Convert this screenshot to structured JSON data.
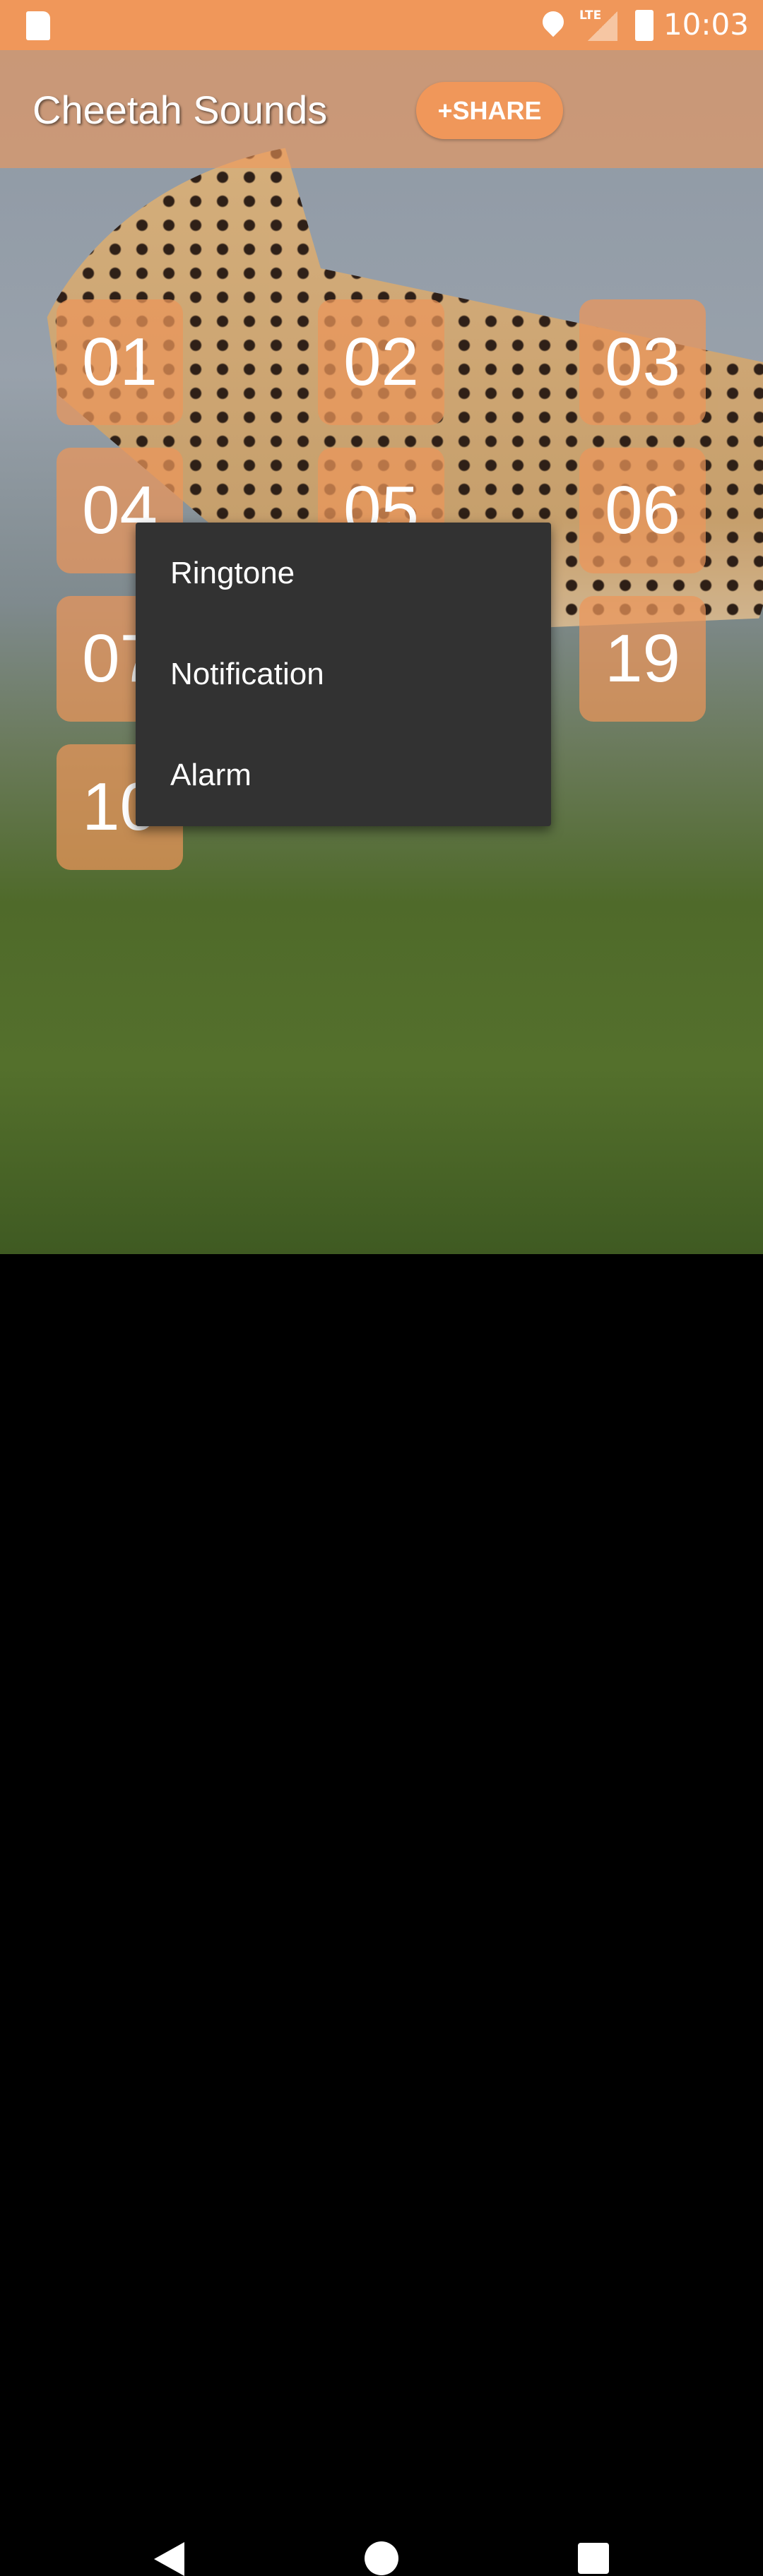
{
  "status_bar": {
    "time": "10:03",
    "network": "LTE",
    "icons": [
      "sd-card-icon",
      "location-icon",
      "signal-icon",
      "battery-charging-icon"
    ]
  },
  "app_bar": {
    "title": "Cheetah Sounds",
    "share_label": "+SHARE"
  },
  "tiles": [
    "01",
    "02",
    "03",
    "04",
    "05",
    "06",
    "07",
    "19",
    "10"
  ],
  "context_menu": {
    "items": [
      "Ringtone",
      "Notification",
      "Alarm"
    ]
  },
  "colors": {
    "accent": "#f0975a",
    "menu": "#323232"
  },
  "nav_bar": {
    "icons": [
      "back-icon",
      "home-icon",
      "recents-icon"
    ]
  }
}
